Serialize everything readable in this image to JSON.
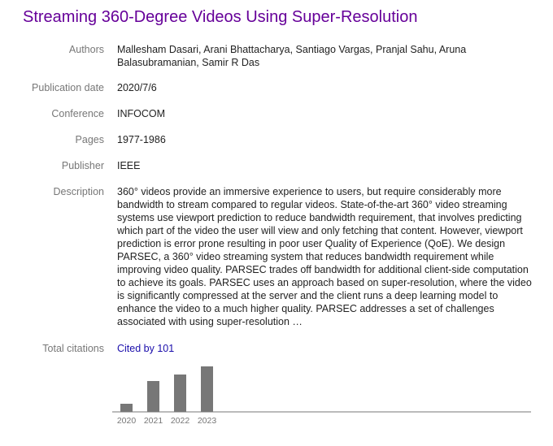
{
  "title": "Streaming 360-Degree Videos Using Super-Resolution",
  "fields": {
    "authors": {
      "label": "Authors",
      "value": "Mallesham Dasari, Arani Bhattacharya, Santiago Vargas, Pranjal Sahu, Aruna Balasubramanian, Samir R Das"
    },
    "publication_date": {
      "label": "Publication date",
      "value": "2020/7/6"
    },
    "conference": {
      "label": "Conference",
      "value": "INFOCOM"
    },
    "pages": {
      "label": "Pages",
      "value": "1977-1986"
    },
    "publisher": {
      "label": "Publisher",
      "value": "IEEE"
    },
    "description": {
      "label": "Description",
      "value": "360° videos provide an immersive experience to users, but require considerably more bandwidth to stream compared to regular videos. State-of-the-art 360° video streaming systems use viewport prediction to reduce bandwidth requirement, that involves predicting which part of the video the user will view and only fetching that content. However, viewport prediction is error prone resulting in poor user Quality of Experience (QoE). We design PARSEC, a 360° video streaming system that reduces bandwidth requirement while improving video quality. PARSEC trades off bandwidth for additional client-side computation to achieve its goals. PARSEC uses an approach based on super-resolution, where the video is significantly compressed at the server and the client runs a deep learning model to enhance the video to a much higher quality. PARSEC addresses a set of challenges associated with using super-resolution …"
    },
    "total_citations": {
      "label": "Total citations",
      "value": "Cited by 101"
    }
  },
  "chart_data": {
    "type": "bar",
    "categories": [
      "2020",
      "2021",
      "2022",
      "2023"
    ],
    "values": [
      5,
      19,
      23,
      28
    ],
    "ylim": [
      0,
      30
    ],
    "grid": false,
    "bar_color": "#777777"
  },
  "colors": {
    "title": "#660099",
    "link": "#1a0dab",
    "label": "#777777",
    "text": "#222222"
  }
}
